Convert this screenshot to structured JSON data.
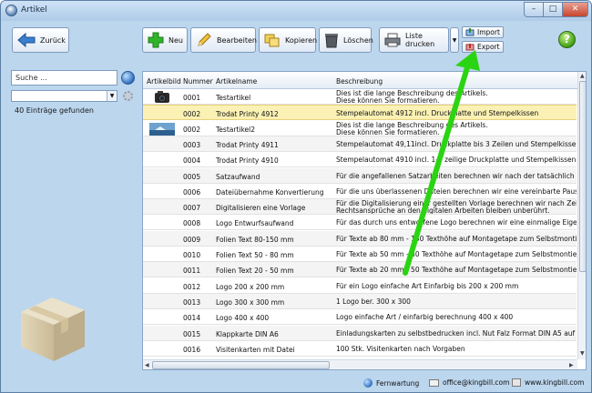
{
  "window": {
    "title": "Artikel",
    "minimize": "–",
    "maximize": "□",
    "close": "✕"
  },
  "toolbar": {
    "back_label": "Zurück",
    "new_label": "Neu",
    "edit_label": "Bearbeiten",
    "copy_label": "Kopieren",
    "delete_label": "Löschen",
    "print_label": "Liste drucken",
    "import_label": "Import",
    "export_label": "Export",
    "help_label": "?"
  },
  "search": {
    "placeholder": "Suche ...",
    "value": "Suche ...",
    "found_text": "40 Einträge gefunden",
    "combo_value": ""
  },
  "table": {
    "columns": [
      "Artikelbild",
      "Nummer",
      "Artikelname",
      "Beschreibung"
    ],
    "rows": [
      {
        "nummer": "0001",
        "name": "Testartikel",
        "desc1": "Dies ist die lange Beschreibung des Artikels.",
        "desc2": "Diese können Sie formatieren.",
        "image": "camera"
      },
      {
        "nummer": "0002",
        "name": "Trodat Printy 4912",
        "desc1": "Stempelautomat 4912 incl. Druckplatte und Stempelkissen",
        "desc2": "",
        "image": ""
      },
      {
        "nummer": "0002",
        "name": "Testartikel2",
        "desc1": "Dies ist die lange Beschreibung des Artikels.",
        "desc2": "Diese können Sie formatieren.",
        "image": "photo"
      },
      {
        "nummer": "0003",
        "name": "Trodat Printy 4911",
        "desc1": "Stempelautomat 49,11incl. Druckplatte bis 3 Zeilen und Stempelkissen",
        "desc2": "",
        "image": ""
      },
      {
        "nummer": "0004",
        "name": "Trodat Printy 4910",
        "desc1": "Stempelautomat 4910 incl. 1-3 zeilige Druckplatte und Stempelkissen",
        "desc2": "",
        "image": ""
      },
      {
        "nummer": "0005",
        "name": "Satzaufwand",
        "desc1": "Für die angefallenen Satzarbeiten berechnen wir nach der tatsächlich benötigten Zeit",
        "desc2": "",
        "image": ""
      },
      {
        "nummer": "0006",
        "name": "Dateiübernahme Konvertierung",
        "desc1": "Für die uns überlassenen Dateien berechnen wir eine vereinbarte Pauschale in Höhe von",
        "desc2": "",
        "image": ""
      },
      {
        "nummer": "0007",
        "name": "Digitalisieren eine Vorlage",
        "desc1": "Für die Digitalisierung einer gestellten Vorlage berechnen wir nach Zeit je angefangene",
        "desc2": "Rechtsansprüche an den digitalen Arbeiten bleiben unberührt.",
        "image": ""
      },
      {
        "nummer": "0008",
        "name": "Logo Entwurfsaufwand",
        "desc1": "Für das durch uns entworfene Logo berechnen wir eine einmalige Eigennutzungsgebühr",
        "desc2": "",
        "image": ""
      },
      {
        "nummer": "0009",
        "name": "Folien Text 80-150 mm",
        "desc1": "Für Texte ab 80 mm - 150 Texthöhe auf Montagetape zum Selbstmontieren berechnen",
        "desc2": "",
        "image": ""
      },
      {
        "nummer": "0010",
        "name": "Folien Text 50 - 80 mm",
        "desc1": "Für Texte ab 50 mm - 80 Texthöhe auf Montagetape zum Selbstmontieren berechnen",
        "desc2": "",
        "image": ""
      },
      {
        "nummer": "0011",
        "name": "Folien Text 20 - 50 mm",
        "desc1": "Für Texte ab 20 mm - 50 Texthöhe auf Montagetape zum Selbstmontieren berechnen",
        "desc2": "",
        "image": ""
      },
      {
        "nummer": "0012",
        "name": "Logo 200 x 200 mm",
        "desc1": "Für ein Logo einfache Art Einfarbig bis 200 x 200 mm",
        "desc2": "",
        "image": ""
      },
      {
        "nummer": "0013",
        "name": "Logo 300 x 300 mm",
        "desc1": "1 Logo ber. 300 x 300",
        "desc2": "",
        "image": ""
      },
      {
        "nummer": "0014",
        "name": "Logo 400 x 400",
        "desc1": "Logo einfache Art / einfarbig berechnung 400 x 400",
        "desc2": "",
        "image": ""
      },
      {
        "nummer": "0015",
        "name": "Klappkarte DIN A6",
        "desc1": "Einladungskarten zu selbstbedrucken incl. Nut Falz Format DIN A5 auf Din A6",
        "desc2": "",
        "image": ""
      },
      {
        "nummer": "0016",
        "name": "Visitenkarten mit Datei",
        "desc1": "100 Stk. Visitenkarten nach Vorgaben",
        "desc2": "",
        "image": ""
      }
    ]
  },
  "status": {
    "remote": "Fernwartung",
    "email": "office@kingbill.com",
    "web": "www.kingbill.com"
  },
  "colors": {
    "accent_green": "#2bd412",
    "selection": "#fbf1b4"
  }
}
